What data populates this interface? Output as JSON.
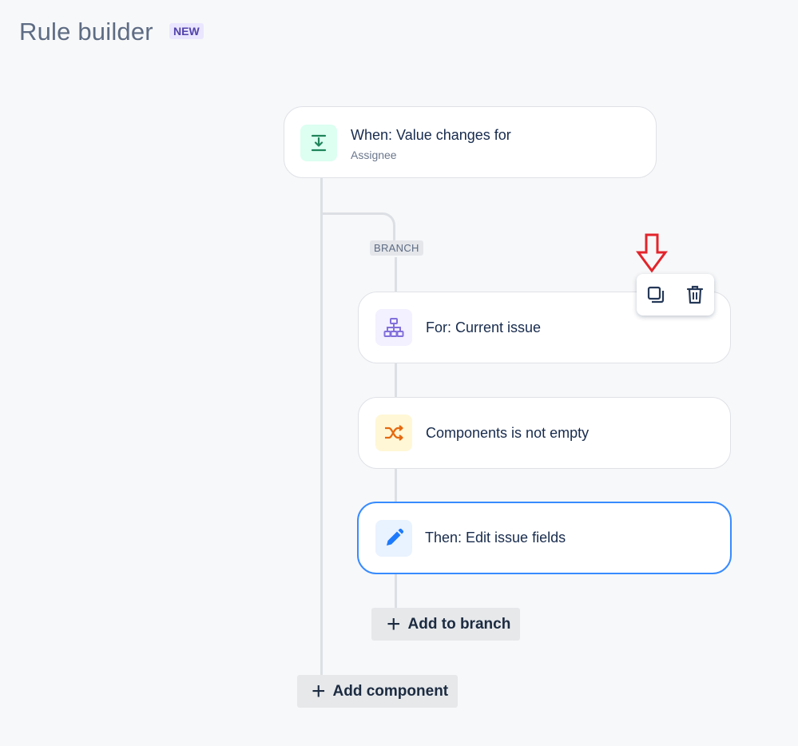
{
  "header": {
    "title": "Rule builder",
    "badge": "NEW"
  },
  "branch_label": "BRANCH",
  "trigger": {
    "title": "When: Value changes for",
    "subtitle": "Assignee",
    "icon": "download-arrow-icon",
    "icon_bg": "#dcfff1",
    "icon_color": "#1f845a"
  },
  "branch_for": {
    "title": "For: Current issue",
    "icon": "hierarchy-icon",
    "icon_bg": "#f3f0ff",
    "icon_color": "#8270db"
  },
  "condition": {
    "title": "Components is not empty",
    "icon": "shuffle-icon",
    "icon_bg": "#fff7d6",
    "icon_color": "#e56910"
  },
  "action": {
    "title": "Then: Edit issue fields",
    "icon": "pencil-icon",
    "icon_bg": "#e9f2ff",
    "icon_color": "#1d7afc",
    "selected": true
  },
  "toolbar": {
    "copy_icon": "copy-icon",
    "delete_icon": "trash-icon"
  },
  "buttons": {
    "add_to_branch": "Add to branch",
    "add_component": "Add component",
    "plus": "+"
  },
  "annotation": {
    "icon": "red-down-arrow-icon",
    "color": "#e3242b"
  },
  "colors": {
    "selected_border": "#388bff",
    "connector": "#dcdfe4"
  }
}
